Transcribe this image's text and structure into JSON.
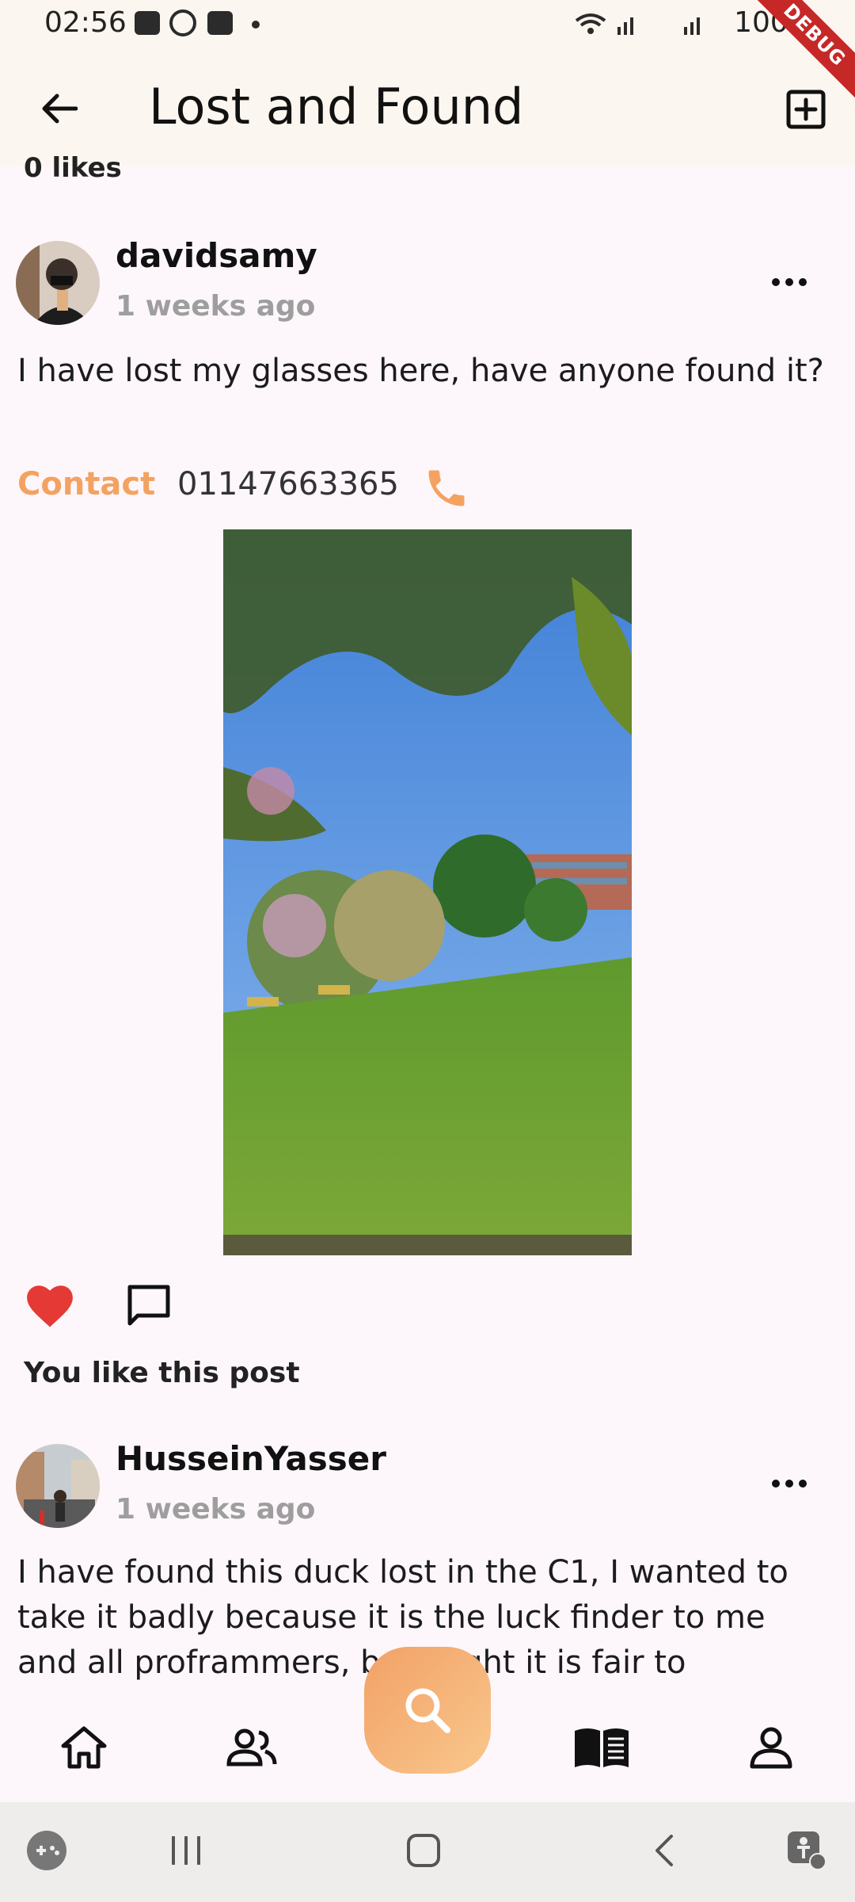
{
  "status_bar": {
    "time": "02:56",
    "battery": "100%",
    "right_text": "100%"
  },
  "app_bar": {
    "title": "Lost and Found",
    "debug_label": "DEBUG"
  },
  "previous_post": {
    "likes": "0 likes"
  },
  "post1": {
    "username": "davidsamy",
    "time_ago": "1 weeks ago",
    "text": "I have lost my glasses here, have anyone found it?",
    "contact_label": "Contact",
    "phone": "01147663365",
    "likes_text": "You like this post"
  },
  "post2": {
    "username": "HusseinYasser",
    "time_ago": "1 weeks ago",
    "text": "I have found this duck lost in the C1, I wanted to take it badly because it is the luck finder to me and all proframmers, b   thought it is fair to"
  },
  "colors": {
    "accent": "#f4a261",
    "heart": "#e53935",
    "background": "#fdf7fb"
  },
  "icons": [
    "arrow-back-icon",
    "add-box-icon",
    "more-icon",
    "phone-icon",
    "heart-icon",
    "comment-icon",
    "home-icon",
    "people-icon",
    "search-icon",
    "book-icon",
    "person-icon"
  ]
}
